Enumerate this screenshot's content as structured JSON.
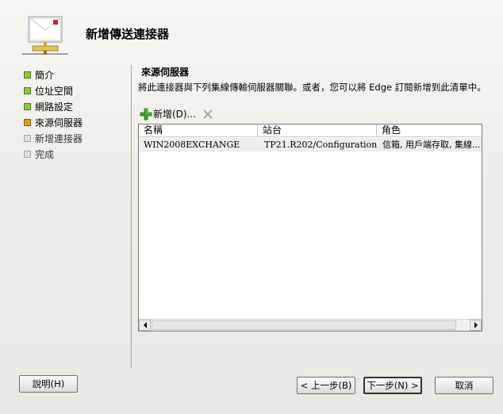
{
  "wizard": {
    "title": "新增傳送連接器",
    "icon": "connector-wizard-icon"
  },
  "steps": [
    {
      "label": "簡介",
      "status": "done"
    },
    {
      "label": "位址空間",
      "status": "done"
    },
    {
      "label": "網路設定",
      "status": "done"
    },
    {
      "label": "來源伺服器",
      "status": "current"
    },
    {
      "label": "新增連接器",
      "status": "todo"
    },
    {
      "label": "完成",
      "status": "todo"
    }
  ],
  "content": {
    "section_title": "來源伺服器",
    "description": "將此連接器與下列集線傳輸伺服器關聯。或者，您可以將 Edge 訂閱新增到此清單中。",
    "toolbar": {
      "add_label": "新增(D)...",
      "add_icon": "plus-icon",
      "remove_icon": "remove-x-icon"
    },
    "table": {
      "columns": [
        "名稱",
        "站台",
        "角色"
      ],
      "rows": [
        [
          "WIN2008EXCHANGE",
          "TP21.R202/Configuration/...",
          "信箱, 用戶端存取, 集線..."
        ]
      ]
    }
  },
  "buttons": {
    "help": "說明(H)",
    "back": "< 上一步(B)",
    "next": "下一步(N) >",
    "cancel": "取消"
  },
  "colors": {
    "step_done": "#8fc63c",
    "step_current": "#d4a21a",
    "step_todo": "#dedede",
    "plus_icon": "#3aa32a"
  }
}
